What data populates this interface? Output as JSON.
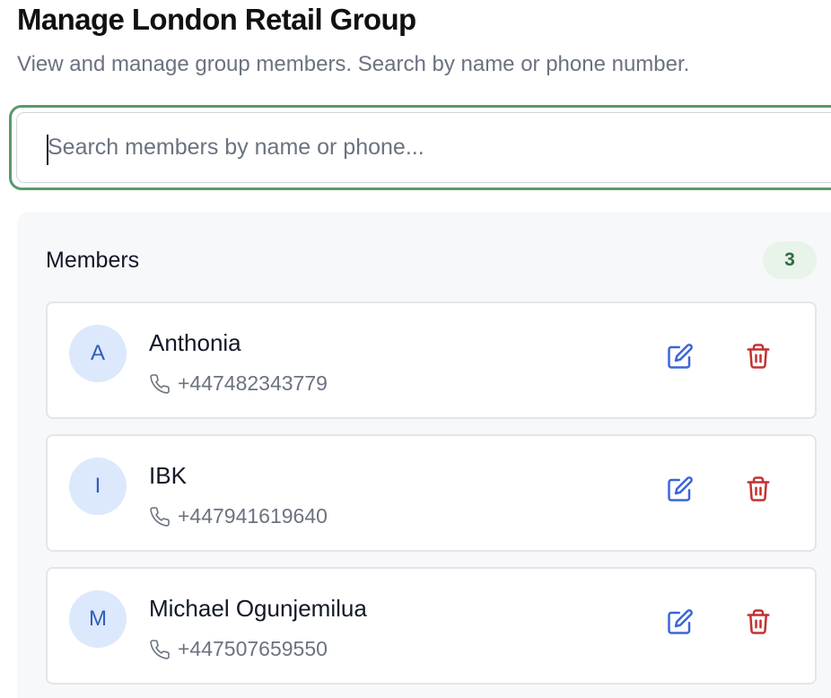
{
  "header": {
    "title": "Manage London Retail Group",
    "subtitle": "View and manage group members. Search by name or phone number."
  },
  "search": {
    "placeholder": "Search members by name or phone...",
    "value": ""
  },
  "members_panel": {
    "title": "Members",
    "count": "3",
    "members": [
      {
        "initial": "A",
        "name": "Anthonia",
        "phone": "+447482343779"
      },
      {
        "initial": "I",
        "name": "IBK",
        "phone": "+447941619640"
      },
      {
        "initial": "M",
        "name": "Michael Ogunjemilua",
        "phone": "+447507659550"
      }
    ]
  },
  "icons": {
    "phone": "phone-icon",
    "edit": "edit-icon",
    "delete": "trash-icon"
  },
  "colors": {
    "search_focus_border": "#5a9a6a",
    "badge_bg": "#e8f3ea",
    "badge_text": "#2f6b3d",
    "avatar_bg": "#dce8fc",
    "avatar_text": "#2f5fb8",
    "edit_icon": "#3a66d6",
    "delete_icon": "#c53030"
  }
}
